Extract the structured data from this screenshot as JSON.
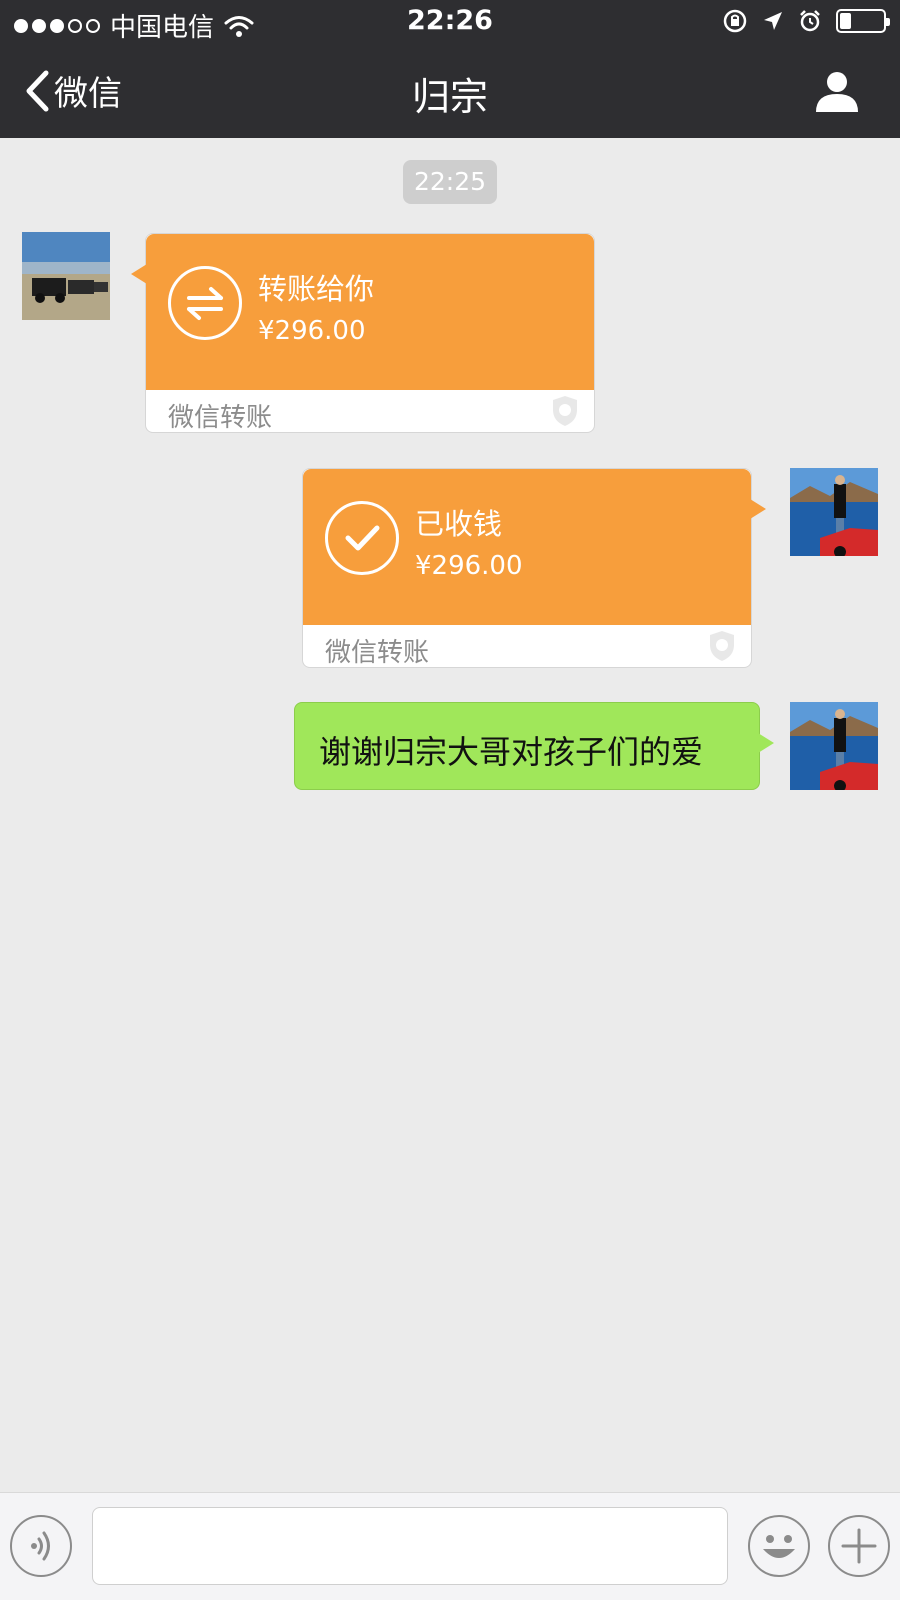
{
  "status_bar": {
    "carrier": "中国电信",
    "time": "22:26",
    "signal_bars_filled": 3,
    "signal_bars_total": 5,
    "battery_level": 0.25
  },
  "nav": {
    "back_label": "微信",
    "title": "归宗",
    "back_icon": "chevron-left-icon",
    "profile_icon": "person-icon"
  },
  "chat": {
    "timestamp": "22:25",
    "messages": [
      {
        "type": "transfer",
        "sender": "other",
        "title": "转账给你",
        "amount": "¥296.00",
        "footer": "微信转账",
        "icon": "transfer-arrows-icon"
      },
      {
        "type": "transfer",
        "sender": "self",
        "title": "已收钱",
        "amount": "¥296.00",
        "footer": "微信转账",
        "icon": "checkmark-icon"
      },
      {
        "type": "text",
        "sender": "self",
        "text": "谢谢归宗大哥对孩子们的爱"
      }
    ]
  },
  "input_bar": {
    "value": "",
    "voice_icon": "voice-icon",
    "emoji_icon": "emoji-icon",
    "plus_icon": "plus-icon"
  },
  "colors": {
    "bar_bg": "#2e2e31",
    "chat_bg": "#ebebeb",
    "transfer_orange": "#f79e3c",
    "bubble_green": "#a0e75a"
  }
}
